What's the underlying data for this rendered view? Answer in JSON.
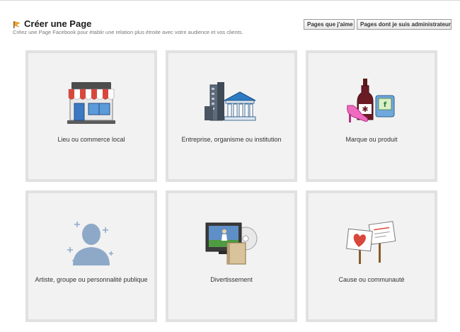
{
  "header": {
    "title": "Créer une Page",
    "subtitle": "Créez une Page Facebook pour établir une relation plus étroite avec votre audience et vos clients."
  },
  "buttons": {
    "liked_pages": "Pages que j'aime",
    "admin_pages": "Pages dont je suis administrateur"
  },
  "categories": [
    {
      "label": "Lieu ou commerce local",
      "icon": "storefront-icon"
    },
    {
      "label": "Entreprise, organisme ou institution",
      "icon": "buildings-icon"
    },
    {
      "label": "Marque ou produit",
      "icon": "products-icon"
    },
    {
      "label": "Artiste, groupe ou personnalité publique",
      "icon": "celebrity-icon"
    },
    {
      "label": "Divertissement",
      "icon": "entertainment-icon"
    },
    {
      "label": "Cause ou communauté",
      "icon": "cause-signs-icon"
    }
  ],
  "colors": {
    "tile_background": "#f2f2f2",
    "tile_border": "#e1e1e1",
    "awning_red": "#d9473c",
    "accent_blue": "#3b79c1"
  }
}
